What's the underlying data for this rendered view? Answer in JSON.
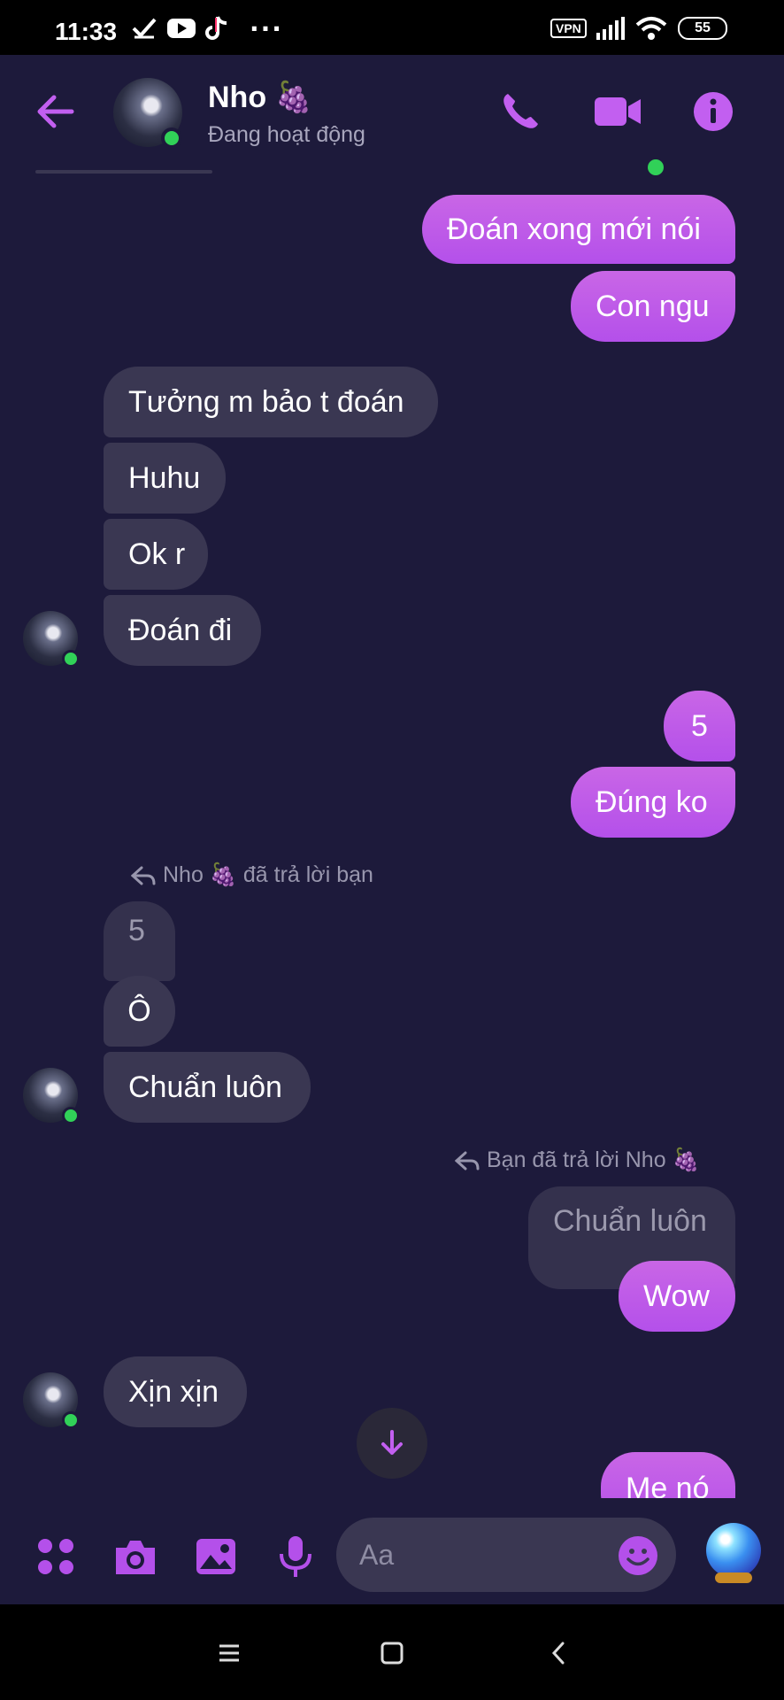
{
  "status_bar": {
    "time": "11:33",
    "vpn_label": "VPN",
    "battery": "55",
    "more_glyph": "···",
    "icons": [
      "check-icon",
      "youtube-icon",
      "tiktok-icon",
      "signal-icon",
      "wifi-icon"
    ]
  },
  "header": {
    "contact_name": "Nho 🍇",
    "contact_status": "Đang hoạt động",
    "icons": [
      "back-arrow-icon",
      "phone-icon",
      "video-camera-icon",
      "info-icon"
    ],
    "accent_color": "#b450ea"
  },
  "messages": [
    {
      "from": "me",
      "text": "Đoán xong mới nói"
    },
    {
      "from": "me",
      "text": "Con ngu"
    },
    {
      "from": "them",
      "text": "Tưởng m bảo t đoán"
    },
    {
      "from": "them",
      "text": "Huhu"
    },
    {
      "from": "them",
      "text": "Ok r"
    },
    {
      "from": "them",
      "text": "Đoán đi"
    },
    {
      "from": "me",
      "text": "5"
    },
    {
      "from": "me",
      "text": "Đúng ko"
    },
    {
      "from": "them",
      "reply_note": "Nho 🍇 đã trả lời bạn",
      "quoted": "5",
      "text": "Ô"
    },
    {
      "from": "them",
      "text": "Chuẩn luôn"
    },
    {
      "from": "me",
      "reply_note": "Bạn đã trả lời Nho 🍇",
      "quoted": "Chuẩn luôn",
      "text": "Wow"
    },
    {
      "from": "them",
      "text": "Xịn xịn"
    },
    {
      "from": "me",
      "text": "Me nó"
    }
  ],
  "composer": {
    "placeholder": "Aa",
    "icons": [
      "apps-grid-icon",
      "camera-icon",
      "image-icon",
      "microphone-icon",
      "emoji-icon",
      "crystal-ball-icon"
    ]
  },
  "nav_bar": {
    "icons": [
      "menu-icon",
      "home-square-icon",
      "back-chevron-icon"
    ]
  },
  "colors": {
    "background": "#1d1a3b",
    "incoming_bubble": "#3a3752",
    "outgoing_bubble": "#b450ea",
    "online": "#31d158"
  }
}
